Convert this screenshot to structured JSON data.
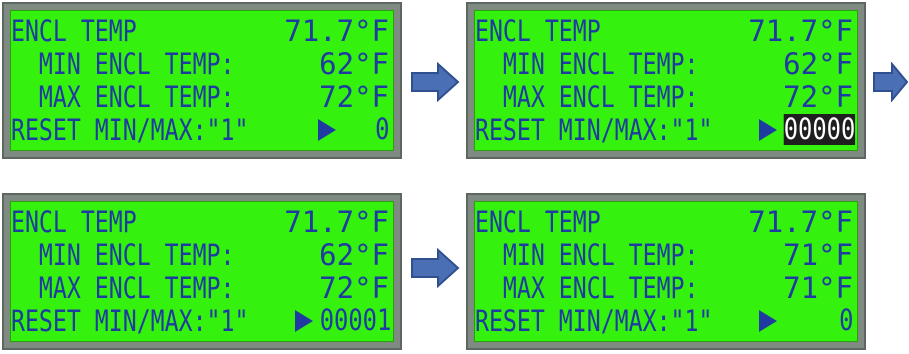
{
  "screens": [
    {
      "line1": {
        "label": "ENCL TEMP",
        "value": "71.7°F"
      },
      "line2": {
        "label": "  MIN ENCL TEMP:",
        "value": "62°F"
      },
      "line3": {
        "label": "  MAX ENCL TEMP:",
        "value": "72°F"
      },
      "line4": {
        "label": "RESET MIN/MAX:\"1\"",
        "entry": "0",
        "entry_selected": false
      }
    },
    {
      "line1": {
        "label": "ENCL TEMP",
        "value": "71.7°F"
      },
      "line2": {
        "label": "  MIN ENCL TEMP:",
        "value": "62°F"
      },
      "line3": {
        "label": "  MAX ENCL TEMP:",
        "value": "72°F"
      },
      "line4": {
        "label": "RESET MIN/MAX:\"1\"",
        "entry": "00000",
        "entry_selected": true
      }
    },
    {
      "line1": {
        "label": "ENCL TEMP",
        "value": "71.7°F"
      },
      "line2": {
        "label": "  MIN ENCL TEMP:",
        "value": "62°F"
      },
      "line3": {
        "label": "  MAX ENCL TEMP:",
        "value": "72°F"
      },
      "line4": {
        "label": "RESET MIN/MAX:\"1\"",
        "entry": "00001",
        "entry_selected": false
      }
    },
    {
      "line1": {
        "label": "ENCL TEMP",
        "value": "71.7°F"
      },
      "line2": {
        "label": "  MIN ENCL TEMP:",
        "value": "71°F"
      },
      "line3": {
        "label": "  MAX ENCL TEMP:",
        "value": "71°F"
      },
      "line4": {
        "label": "RESET MIN/MAX:\"1\"",
        "entry": "0",
        "entry_selected": false
      }
    }
  ],
  "icons": {
    "cursor": "play-triangle-icon",
    "flow": "right-arrow-icon"
  },
  "colors": {
    "lcd_background": "#34f20e",
    "lcd_text": "#1f3aa0",
    "bezel": "#7f8b82",
    "flow_arrow": "#4a6fb5",
    "selection": "#1f1f1f"
  }
}
